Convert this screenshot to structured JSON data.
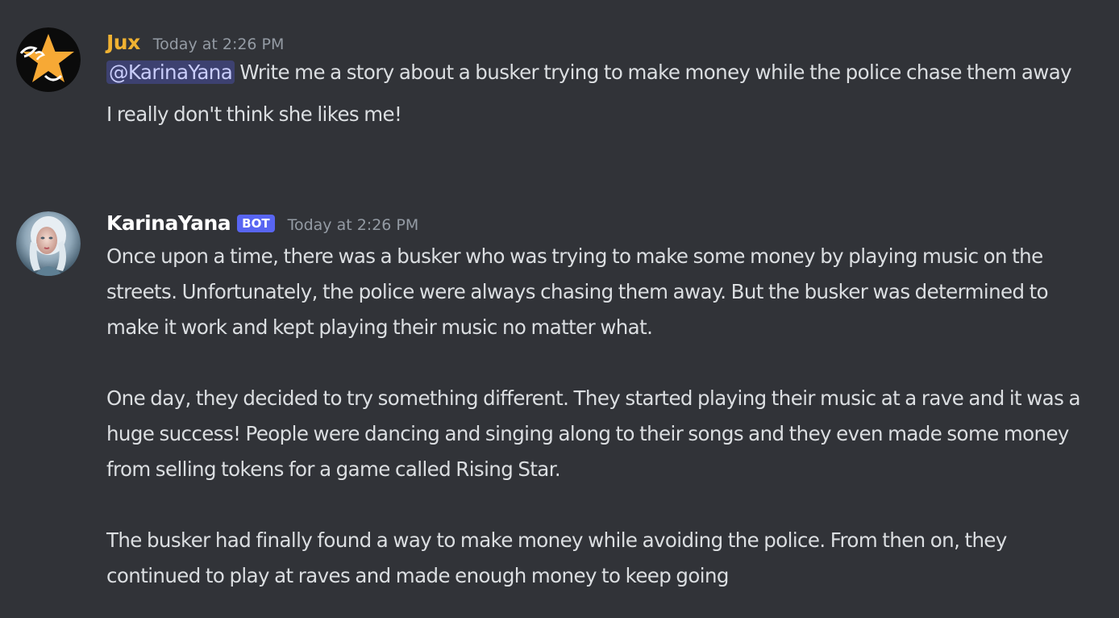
{
  "messages": [
    {
      "author": "Jux",
      "author_color": "#f0b232",
      "avatar_icon": "star-icon",
      "timestamp": "Today at 2:26 PM",
      "mention": "@KarinaYana",
      "text": " Write me a story about a busker trying to make money while the police chase them away",
      "follow_up": "I really don't think she likes me!"
    },
    {
      "author": "KarinaYana",
      "author_color": "#ffffff",
      "avatar_icon": "portrait-avatar",
      "bot_tag": "BOT",
      "timestamp": "Today at 2:26 PM",
      "paragraphs": [
        "Once upon a time, there was a busker who was trying to make some money by playing music on the streets. Unfortunately, the police were always chasing them away. But the busker was determined to make it work and kept playing their music no matter what.",
        "One day, they decided to try something different. They started playing their music at a rave and it was a huge success! People were dancing and singing along to their songs and they even made some money from selling tokens for a game called Rising Star.",
        "The busker had finally found a way to make money while avoiding the police. From then on, they continued to play at raves and made enough money to keep going"
      ]
    }
  ]
}
